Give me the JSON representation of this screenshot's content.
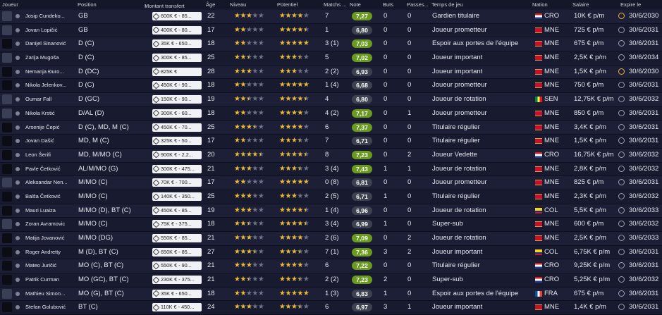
{
  "header": {
    "joueur": "Joueur",
    "position": "Position",
    "montant": "Montant transfert",
    "age": "Âge",
    "niveau": "Niveau",
    "potentiel": "Potentiel",
    "matchs": "Matchs ...",
    "note": "Note",
    "buts": "Buts",
    "passes": "Passes...",
    "temps": "Temps de jeu",
    "nation": "Nation",
    "salaire": "Salaire",
    "expire": "Expire le"
  },
  "colors": {
    "note_green": "#6a9a1f",
    "note_dark": "#3d4250",
    "star": "#e8b93a",
    "warn_clock": "#f0b33a"
  },
  "rows": [
    {
      "name": "Josip Cundeko...",
      "photo": "light",
      "position": "GB",
      "value": "600K € - 85...",
      "age": "22",
      "level": 3,
      "potential": 4,
      "apps": "7",
      "note": "7,27",
      "note_color": "#6a9a1f",
      "goals": "0",
      "assists": "0",
      "role": "Gardien titulaire",
      "nat": "CRO",
      "flag": "cro",
      "salary": "10K € p/m",
      "clock": "warn",
      "expires": "30/6/2030"
    },
    {
      "name": "Jovan Lopičić",
      "photo": "light",
      "position": "GB",
      "value": "400K € - 80...",
      "age": "17",
      "level": 2,
      "potential": 4.5,
      "apps": "1",
      "note": "6,80",
      "note_color": "#3d4250",
      "goals": "0",
      "assists": "0",
      "role": "Joueur prometteur",
      "nat": "MNE",
      "flag": "mne",
      "salary": "725 € p/m",
      "clock": "ok",
      "expires": "30/6/2031"
    },
    {
      "name": "Danijel Sinanović",
      "photo": "dark",
      "position": "D (C)",
      "value": "35K € - 650...",
      "age": "18",
      "level": 2,
      "potential": 5,
      "apps": "3 (1)",
      "note": "7,03",
      "note_color": "#6a9a1f",
      "goals": "0",
      "assists": "0",
      "role": "Espoir aux portes de l'équipe",
      "nat": "MNE",
      "flag": "mne",
      "salary": "675 € p/m",
      "clock": "ok",
      "expires": "30/6/2031"
    },
    {
      "name": "Zarija Mugoša",
      "photo": "light",
      "position": "D (C)",
      "value": "300K € - 85...",
      "age": "25",
      "level": 2.5,
      "potential": 3.5,
      "apps": "5",
      "note": "7,02",
      "note_color": "#6a9a1f",
      "goals": "0",
      "assists": "0",
      "role": "Joueur important",
      "nat": "MNE",
      "flag": "mne",
      "salary": "2,5K € p/m",
      "clock": "ok",
      "expires": "30/6/2034"
    },
    {
      "name": "Nemanja Đuro...",
      "photo": "dark",
      "position": "D (DC)",
      "value": "825K €",
      "age": "28",
      "level": 3,
      "potential": 3,
      "apps": "2 (2)",
      "note": "6,93",
      "note_color": "#3d4250",
      "goals": "0",
      "assists": "0",
      "role": "Joueur important",
      "nat": "MNE",
      "flag": "mne",
      "salary": "1,5K € p/m",
      "clock": "warn",
      "expires": "30/6/2030"
    },
    {
      "name": "Nikola Jelenkov...",
      "photo": "dark",
      "position": "D (C)",
      "value": "450K € - 90...",
      "age": "18",
      "level": 2,
      "potential": 5,
      "apps": "1 (4)",
      "note": "6,68",
      "note_color": "#3d4250",
      "goals": "0",
      "assists": "0",
      "role": "Joueur prometteur",
      "nat": "MNE",
      "flag": "mne",
      "salary": "750 € p/m",
      "clock": "ok",
      "expires": "30/6/2031"
    },
    {
      "name": "Oumar Fall",
      "photo": "light",
      "position": "D (GC)",
      "value": "150K € - 90...",
      "age": "19",
      "level": 2.5,
      "potential": 4.5,
      "apps": "4",
      "note": "6,80",
      "note_color": "#3d4250",
      "goals": "0",
      "assists": "0",
      "role": "Joueur de rotation",
      "nat": "SEN",
      "flag": "sen",
      "salary": "12,75K € p/m",
      "clock": "ok",
      "expires": "30/6/2032"
    },
    {
      "name": "Nikola Krstić",
      "photo": "light",
      "position": "D/AL (D)",
      "value": "300K € - 60...",
      "age": "18",
      "level": 2,
      "potential": 4,
      "apps": "4 (2)",
      "note": "7,17",
      "note_color": "#6a9a1f",
      "goals": "0",
      "assists": "1",
      "role": "Joueur prometteur",
      "nat": "MNE",
      "flag": "mne",
      "salary": "850 € p/m",
      "clock": "ok",
      "expires": "30/6/2031"
    },
    {
      "name": "Arsenije Čepić",
      "photo": "dark",
      "position": "D (C), MD, M (C)",
      "value": "450K € - 70...",
      "age": "25",
      "level": 3.5,
      "potential": 4,
      "apps": "6",
      "note": "7,37",
      "note_color": "#6a9a1f",
      "goals": "0",
      "assists": "0",
      "role": "Titulaire régulier",
      "nat": "MNE",
      "flag": "mne",
      "salary": "3,4K € p/m",
      "clock": "ok",
      "expires": "30/6/2031"
    },
    {
      "name": "Jovan Dašić",
      "photo": "dark",
      "position": "MD, M (C)",
      "value": "325K € - 50...",
      "age": "17",
      "level": 2,
      "potential": 3.5,
      "apps": "7",
      "note": "6,71",
      "note_color": "#3d4250",
      "goals": "0",
      "assists": "0",
      "role": "Titulaire régulier",
      "nat": "MNE",
      "flag": "mne",
      "salary": "1,5K € p/m",
      "clock": "ok",
      "expires": "30/6/2031"
    },
    {
      "name": "Leon Šerifi",
      "photo": "dark",
      "position": "MD, M/MO (C)",
      "value": "900K € - 2,2...",
      "age": "20",
      "level": 4.5,
      "potential": 4.5,
      "apps": "8",
      "note": "7,23",
      "note_color": "#6a9a1f",
      "goals": "0",
      "assists": "2",
      "role": "Joueur Vedette",
      "nat": "CRO",
      "flag": "cro",
      "salary": "16,75K € p/m",
      "clock": "ok",
      "expires": "30/6/2032"
    },
    {
      "name": "Pavle Četković",
      "photo": "dark",
      "position": "AL/M/MO (G)",
      "value": "300K € - 475...",
      "age": "21",
      "level": 3,
      "potential": 3.5,
      "apps": "3 (4)",
      "note": "7,43",
      "note_color": "#6a9a1f",
      "goals": "1",
      "assists": "1",
      "role": "Joueur de rotation",
      "nat": "MNE",
      "flag": "mne",
      "salary": "2,8K € p/m",
      "clock": "ok",
      "expires": "30/6/2032"
    },
    {
      "name": "Aleksandar Nen...",
      "photo": "light",
      "position": "M/MO (C)",
      "value": "70K € - 700...",
      "age": "17",
      "level": 2,
      "potential": 5,
      "apps": "0 (8)",
      "note": "6,81",
      "note_color": "#3d4250",
      "goals": "0",
      "assists": "0",
      "role": "Joueur prometteur",
      "nat": "MNE",
      "flag": "mne",
      "salary": "825 € p/m",
      "clock": "ok",
      "expires": "30/6/2031"
    },
    {
      "name": "Balša Četković",
      "photo": "dark",
      "position": "M/MO (C)",
      "value": "140K € - 350...",
      "age": "25",
      "level": 3,
      "potential": 3,
      "apps": "2 (5)",
      "note": "6,71",
      "note_color": "#3d4250",
      "goals": "1",
      "assists": "0",
      "role": "Titulaire régulier",
      "nat": "MNE",
      "flag": "mne",
      "salary": "2,3K € p/m",
      "clock": "ok",
      "expires": "30/6/2032"
    },
    {
      "name": "Mauri Luaiza",
      "photo": "dark",
      "position": "M/MO (D), BT (C)",
      "value": "450K € - 85...",
      "age": "19",
      "level": 3,
      "potential": 4.5,
      "apps": "1 (4)",
      "note": "6,96",
      "note_color": "#3d4250",
      "goals": "0",
      "assists": "0",
      "role": "Joueur de rotation",
      "nat": "COL",
      "flag": "col",
      "salary": "5,5K € p/m",
      "clock": "ok",
      "expires": "30/6/2033"
    },
    {
      "name": "Zoran Avramovic",
      "photo": "light",
      "position": "M/MO (C)",
      "value": "75K € - 375...",
      "age": "18",
      "level": 2.5,
      "potential": 4.5,
      "apps": "3 (4)",
      "note": "6,99",
      "note_color": "#3d4250",
      "goals": "1",
      "assists": "0",
      "role": "Super-sub",
      "nat": "MNE",
      "flag": "mne",
      "salary": "600 € p/m",
      "clock": "ok",
      "expires": "30/6/2032"
    },
    {
      "name": "Matija Jovanović",
      "photo": "dark",
      "position": "M/MO (DG)",
      "value": "550K € - 85...",
      "age": "21",
      "level": 3,
      "potential": 4,
      "apps": "2 (6)",
      "note": "7,09",
      "note_color": "#6a9a1f",
      "goals": "0",
      "assists": "2",
      "role": "Joueur de rotation",
      "nat": "MNE",
      "flag": "mne",
      "salary": "2,5K € p/m",
      "clock": "ok",
      "expires": "30/6/2033"
    },
    {
      "name": "Roger Andretty",
      "photo": "dark",
      "position": "M (D), BT (C)",
      "value": "650K € - 85...",
      "age": "27",
      "level": 3.5,
      "potential": 3.5,
      "apps": "7 (1)",
      "note": "7,36",
      "note_color": "#6a9a1f",
      "goals": "3",
      "assists": "2",
      "role": "Joueur important",
      "nat": "COL",
      "flag": "col",
      "salary": "6,75K € p/m",
      "clock": "ok",
      "expires": "30/6/2031"
    },
    {
      "name": "Mateo Juričić",
      "photo": "dark",
      "position": "MO (C), BT (C)",
      "value": "550K € - 90...",
      "age": "21",
      "level": 3,
      "potential": 4,
      "apps": "6",
      "note": "7,22",
      "note_color": "#6a9a1f",
      "goals": "0",
      "assists": "0",
      "role": "Titulaire régulier",
      "nat": "CRO",
      "flag": "cro",
      "salary": "9,25K € p/m",
      "clock": "ok",
      "expires": "30/6/2031"
    },
    {
      "name": "Patrik Curman",
      "photo": "dark",
      "position": "MO (GC), BT (C)",
      "value": "230K € - 375...",
      "age": "21",
      "level": 2.5,
      "potential": 3.5,
      "apps": "2 (2)",
      "note": "7,23",
      "note_color": "#6a9a1f",
      "goals": "2",
      "assists": "0",
      "role": "Super-sub",
      "nat": "CRO",
      "flag": "cro",
      "salary": "5,25K € p/m",
      "clock": "ok",
      "expires": "30/6/2032"
    },
    {
      "name": "Mathieu Simon...",
      "photo": "light",
      "position": "MO (G), BT (C)",
      "value": "35K € - 650...",
      "age": "18",
      "level": 2,
      "potential": 5,
      "apps": "1 (3)",
      "note": "6,83",
      "note_color": "#3d4250",
      "goals": "1",
      "assists": "0",
      "role": "Espoir aux portes de l'équipe",
      "nat": "FRA",
      "flag": "fra",
      "salary": "675 € p/m",
      "clock": "ok",
      "expires": "30/6/2031"
    },
    {
      "name": "Stefan Golubović",
      "photo": "dark",
      "position": "BT (C)",
      "value": "110K € - 450...",
      "age": "24",
      "level": 3,
      "potential": 3.5,
      "apps": "6",
      "note": "6,97",
      "note_color": "#3d4250",
      "goals": "3",
      "assists": "1",
      "role": "Joueur important",
      "nat": "MNE",
      "flag": "mne",
      "salary": "1,4K € p/m",
      "clock": "ok",
      "expires": "30/6/2031"
    }
  ]
}
